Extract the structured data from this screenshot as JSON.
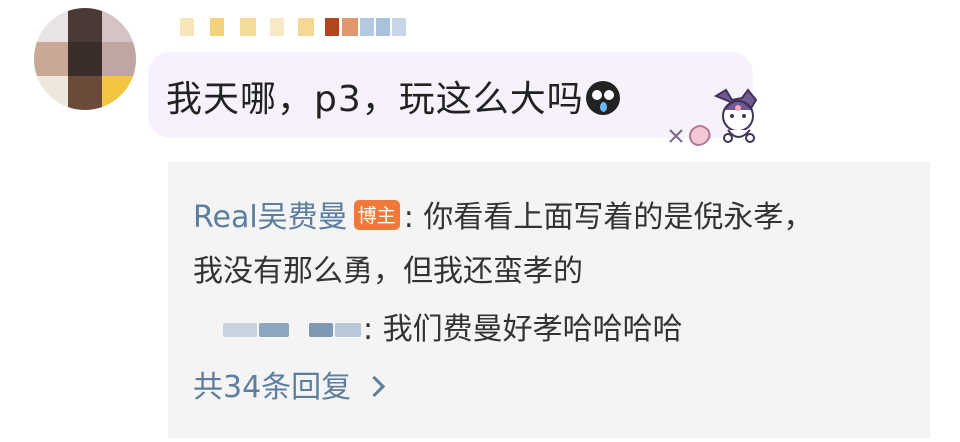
{
  "comment": {
    "text": "我天哪，p3，玩这么大吗",
    "emoji": "crying-face-icon",
    "sticker": "kuromi-sticker"
  },
  "replies": {
    "author": "Real吴费曼",
    "author_badge": "博主",
    "reply1_sep": ":",
    "reply1_line1": " 你看看上面写着的是倪永孝，",
    "reply1_line2": "我没有那么勇，但我还蛮孝的",
    "reply2_sep": ":",
    "reply2_text": " 我们费曼好孝哈哈哈哈",
    "more_label": "共34条回复"
  },
  "colors": {
    "link": "#5d7e9e",
    "badge": "#f07838",
    "bubble": "#f6f1fa",
    "reply_bg": "#f4f4f4"
  }
}
